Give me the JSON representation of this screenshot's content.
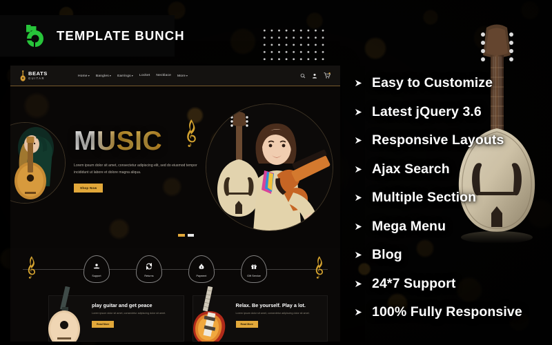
{
  "brand": {
    "name": "TEMPLATE BUNCH",
    "logo_icon": "templatebunch-b-logo-icon",
    "accent": "#27c43a"
  },
  "features": {
    "arrow_icon": "arrow-right-triangle-icon",
    "items": [
      "Easy to Customize",
      "Latest jQuery 3.6",
      "Responsive Layouts",
      "Ajax Search",
      "Multiple Section",
      "Mega Menu",
      "Blog",
      "24*7 Support",
      "100% Fully Responsive"
    ]
  },
  "site": {
    "header": {
      "logo_icon": "guitar-icon",
      "brand_primary": "BEATS",
      "brand_secondary": "GUITAR",
      "nav": [
        {
          "label": "Home",
          "caret": "▾"
        },
        {
          "label": "Bangles",
          "caret": "▾"
        },
        {
          "label": "Earrings",
          "caret": "▾"
        },
        {
          "label": "Locket",
          "caret": ""
        },
        {
          "label": "Necklace",
          "caret": ""
        },
        {
          "label": "More",
          "caret": "▾"
        }
      ],
      "icons": [
        {
          "name": "search-icon"
        },
        {
          "name": "user-account-icon"
        },
        {
          "name": "shopping-cart-icon",
          "badge": "0"
        }
      ]
    },
    "hero": {
      "title": "MUSIC",
      "paragraph": "Lorem ipsum dolor sit amet, consectetur adipiscing elit, sed do eiusmod tempor incididunt ut labore et dolore magna aliqua.",
      "cta_label": "Shop Now",
      "clef_icon": "treble-clef-icon",
      "left_image": "woman-with-acoustic-guitar",
      "right_image": "woman-with-violin-and-mandolin",
      "slider_dots": 2,
      "active_dot": 1
    },
    "services": {
      "end_icon": "treble-clef-icon",
      "items": [
        {
          "label": "Support",
          "icon": "headset-support-icon"
        },
        {
          "label": "Returns",
          "icon": "return-exchange-icon"
        },
        {
          "label": "Payment",
          "icon": "money-bag-icon"
        },
        {
          "label": "Gift Service",
          "icon": "gift-box-icon"
        }
      ]
    },
    "cards": [
      {
        "title": "play guitar and get peace",
        "subtitle": "Lorem ipsum dolor sit amet, consectetur adipiscing dolor sit amet.",
        "button": "Read More",
        "image": "acoustic-guitar"
      },
      {
        "title": "Relax. Be yourself. Play a lot.",
        "subtitle": "Lorem ipsum dolor sit amet, consectetur adipiscing dolor sit amet.",
        "button": "Read More",
        "image": "electric-les-paul-guitar"
      }
    ]
  },
  "decor": {
    "dot_grid": {
      "cols": 10,
      "rows": 6
    },
    "mandolin_image": "mandolin-instrument"
  }
}
